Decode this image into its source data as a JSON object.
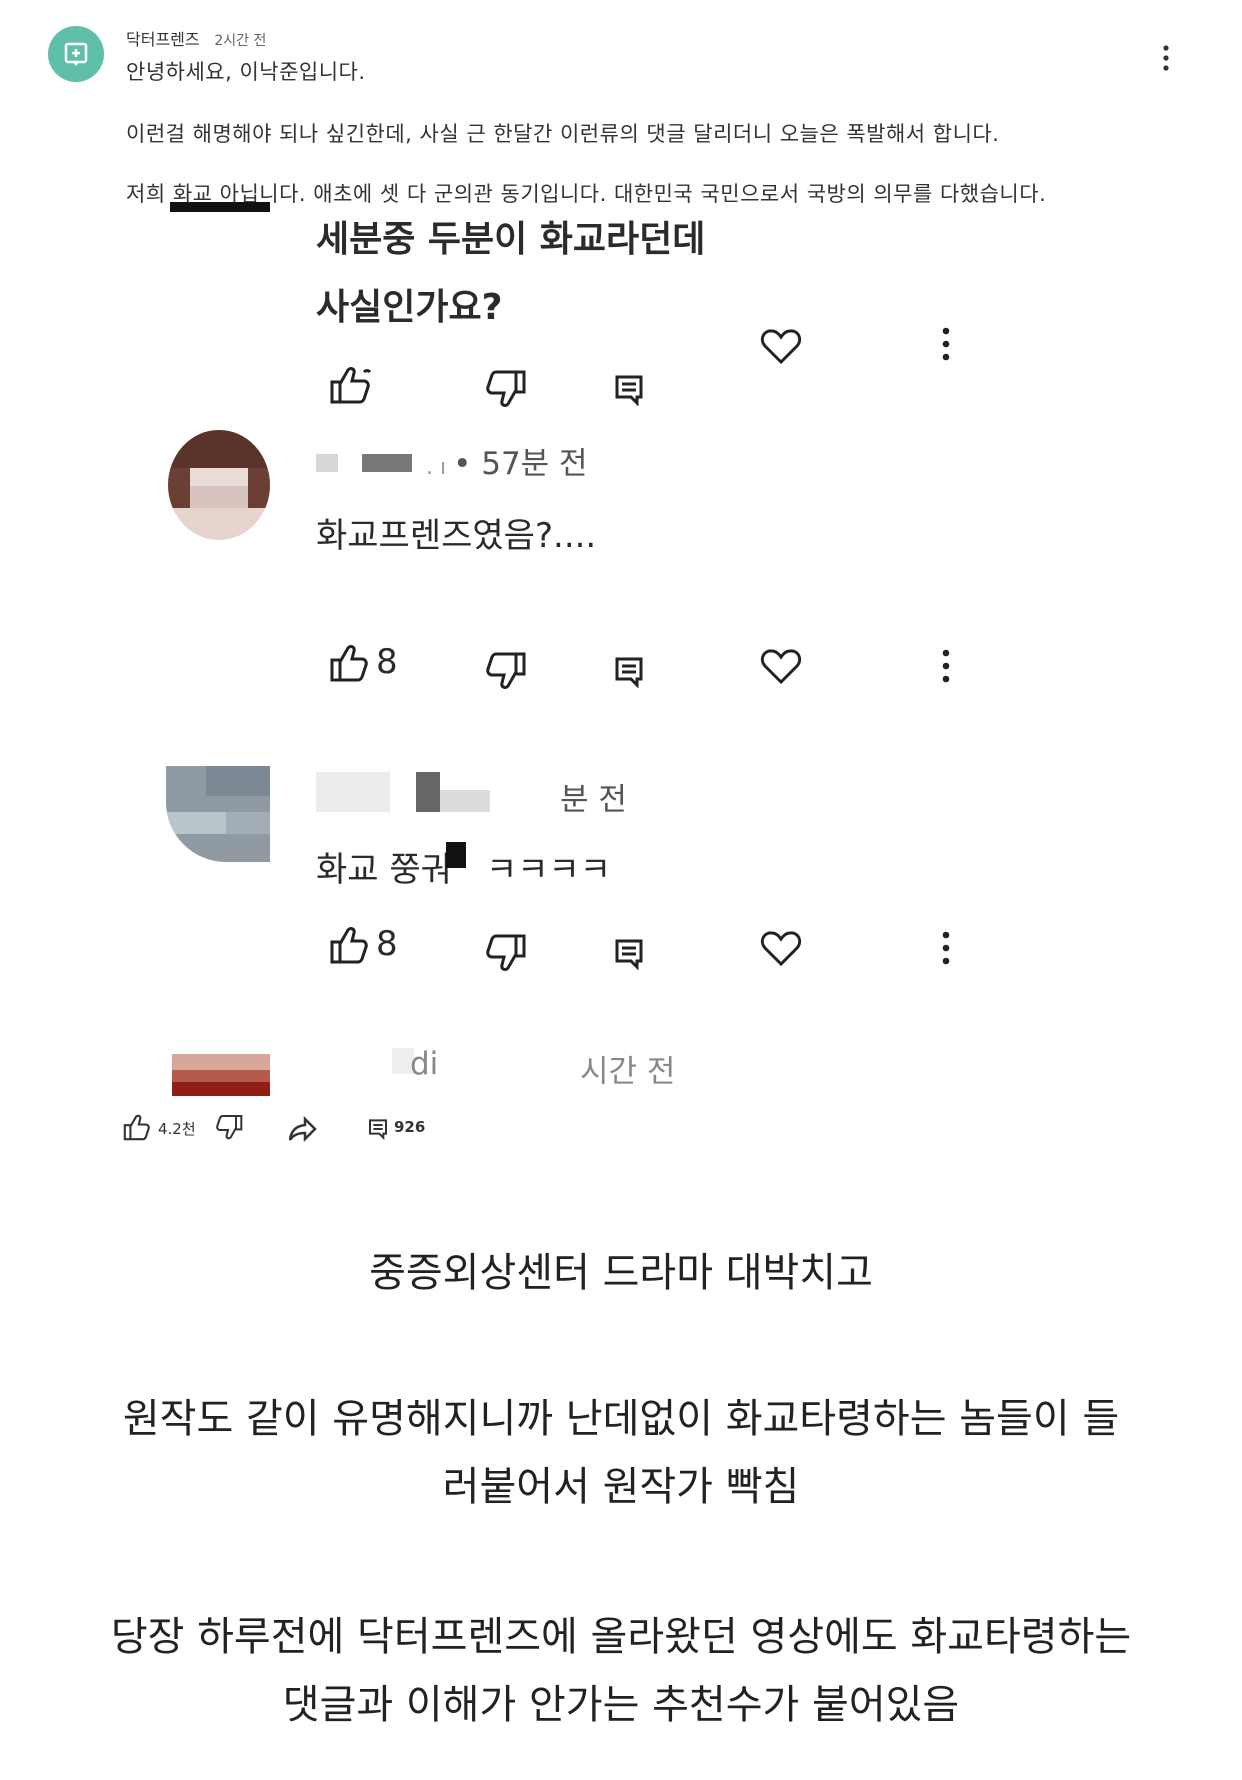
{
  "top_comment": {
    "author": "닥터프렌즈",
    "time": "2시간 전",
    "lines": [
      "안녕하세요, 이낙준입니다.",
      "이런걸 해명해야 되나 싶긴한데, 사실 근 한달간 이런류의 댓글 달리더니 오늘은 폭발해서 합니다.",
      "저희 화교 아닙니다. 애초에 셋 다 군의관 동기입니다. 대한민국 국민으로서 국방의 의무를 다했습니다."
    ]
  },
  "embedded": {
    "c1_line1": "세분중 두분이 화교라던데",
    "c1_line2": "사실인가요?",
    "c2_time": "• 57분 전",
    "c2_text": "화교프렌즈였음?....",
    "c2_likes": "8",
    "c3_time": "분 전",
    "c3_text_a": "화교 쭝궈",
    "c3_text_b": "ㅋㅋㅋㅋ",
    "c3_likes": "8",
    "c4_name_tail": "di",
    "c4_time": "시간 전"
  },
  "stats": {
    "likes": "4.2천",
    "replies": "926"
  },
  "captions": [
    "중증외상센터 드라마 대박치고",
    "원작도 같이 유명해지니까 난데없이 화교타령하는 놈들이 들",
    "러붙어서 원작가 빡침",
    "당장 하루전에 닥터프렌즈에 올라왔던 영상에도 화교타령하는",
    "댓글과 이해가 안가는 추천수가 붙어있음"
  ],
  "colors": {
    "avatar": "#5fbfa8",
    "caption": "#222222"
  }
}
